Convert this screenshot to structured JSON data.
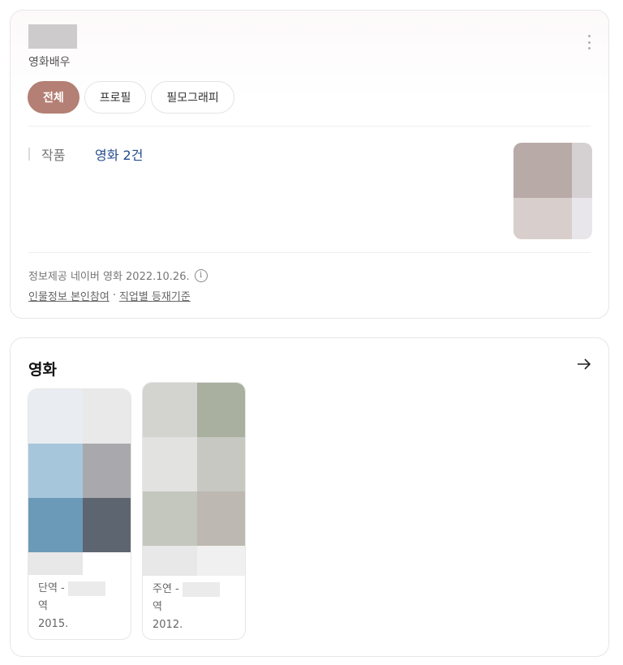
{
  "profile": {
    "subtitle": "영화배우",
    "tabs": [
      {
        "label": "전체",
        "active": true
      },
      {
        "label": "프로필",
        "active": false
      },
      {
        "label": "필모그래피",
        "active": false
      }
    ],
    "works": {
      "label": "작품",
      "link": "영화 2건"
    },
    "source": "정보제공 네이버 영화 2022.10.26.",
    "info_icon_glyph": "i",
    "links": [
      "인물정보 본인참여",
      "직업별 등재기준"
    ],
    "link_separator": "·"
  },
  "movies": {
    "title": "영화",
    "items": [
      {
        "role": "단역 -",
        "role_suffix": "역",
        "year": "2015.",
        "poster_colors": [
          "#e9edf1",
          "#e9e9ea",
          "#a6c6dc",
          "#a8a8ad",
          "#6b9ab8",
          "#5d6570",
          "#e8e8e8",
          "#ffffff"
        ]
      },
      {
        "role": "주연 -",
        "role_suffix": "역",
        "year": "2012.",
        "poster_colors": [
          "#d3d4cf",
          "#a9b0a0",
          "#e2e2e1",
          "#c8c8c3",
          "#c3c7be",
          "#bdb8b1",
          "#e8e8e8",
          "#f0f0f0"
        ]
      }
    ]
  },
  "colors": {
    "accent": "#b47f74",
    "link": "#234b8c"
  }
}
